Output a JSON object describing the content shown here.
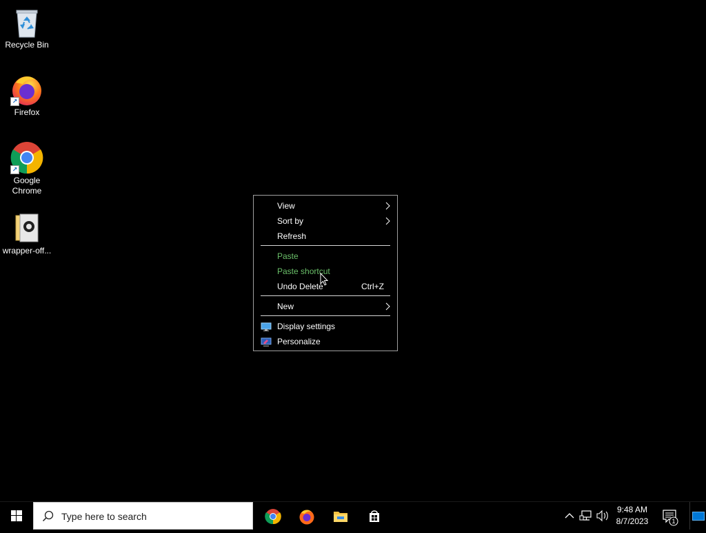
{
  "desktop": {
    "icons": [
      {
        "label": "Recycle Bin"
      },
      {
        "label": "Firefox"
      },
      {
        "label": "Google Chrome"
      },
      {
        "label": "wrapper-off..."
      }
    ]
  },
  "context_menu": {
    "items": [
      {
        "label": "View",
        "has_submenu": true
      },
      {
        "label": "Sort by",
        "has_submenu": true
      },
      {
        "label": "Refresh"
      },
      {
        "label": "Paste",
        "disabled": true
      },
      {
        "label": "Paste shortcut",
        "disabled": true
      },
      {
        "label": "Undo Delete",
        "shortcut": "Ctrl+Z"
      },
      {
        "label": "New",
        "has_submenu": true
      },
      {
        "label": "Display settings",
        "icon": "display-settings-icon"
      },
      {
        "label": "Personalize",
        "icon": "personalize-icon"
      }
    ],
    "submenu_glyph": ">"
  },
  "taskbar": {
    "search_placeholder": "Type here to search",
    "pinned": [
      "chrome-icon",
      "firefox-icon",
      "file-explorer-icon",
      "store-icon"
    ],
    "clock": {
      "time": "9:48 AM",
      "date": "8/7/2023"
    },
    "notification_count": "1",
    "colors": {
      "accent": "#0078d7",
      "disabled_text": "#6abf69"
    }
  }
}
